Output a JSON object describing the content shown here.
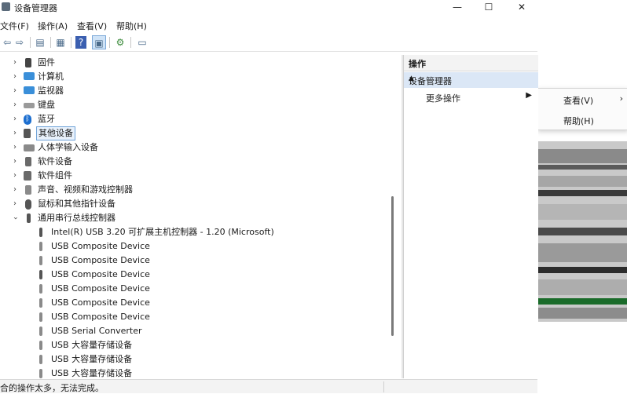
{
  "window": {
    "title": "设备管理器",
    "controls": {
      "minimize": "—",
      "maximize": "☐",
      "close": "✕"
    }
  },
  "menubar": {
    "file": "文件(F)",
    "action": "操作(A)",
    "view": "查看(V)",
    "help": "帮助(H)"
  },
  "toolbar": {
    "back": "back-icon",
    "forward": "forward-icon",
    "properties": "properties-icon",
    "show_hide": "show-hide-icon",
    "help": "help-icon",
    "update": "update-driver-icon",
    "scan": "scan-icon",
    "monitor": "monitor-icon"
  },
  "tree": {
    "items": [
      {
        "label": "固件",
        "expanded": false,
        "icon": "firmware-icon",
        "color": "#444444"
      },
      {
        "label": "计算机",
        "expanded": false,
        "icon": "computer-icon",
        "color": "#3a8fd9"
      },
      {
        "label": "监视器",
        "expanded": false,
        "icon": "monitor-icon",
        "color": "#3a8fd9"
      },
      {
        "label": "键盘",
        "expanded": false,
        "icon": "keyboard-icon",
        "color": "#777777"
      },
      {
        "label": "蓝牙",
        "expanded": false,
        "icon": "bluetooth-icon",
        "color": "#1d6fd0"
      },
      {
        "label": "其他设备",
        "expanded": false,
        "icon": "other-devices-icon",
        "color": "#555555",
        "selected": true
      },
      {
        "label": "人体学输入设备",
        "expanded": false,
        "icon": "hid-icon",
        "color": "#666666"
      },
      {
        "label": "软件设备",
        "expanded": false,
        "icon": "software-device-icon",
        "color": "#666666"
      },
      {
        "label": "软件组件",
        "expanded": false,
        "icon": "software-component-icon",
        "color": "#666666"
      },
      {
        "label": "声音、视频和游戏控制器",
        "expanded": false,
        "icon": "audio-icon",
        "color": "#777777"
      },
      {
        "label": "鼠标和其他指针设备",
        "expanded": false,
        "icon": "mouse-icon",
        "color": "#555555"
      },
      {
        "label": "通用串行总线控制器",
        "expanded": true,
        "icon": "usb-icon",
        "color": "#555555"
      }
    ],
    "usb_children": [
      "Intel(R) USB 3.20 可扩展主机控制器 - 1.20 (Microsoft)",
      "USB Composite Device",
      "USB Composite Device",
      "USB Composite Device",
      "USB Composite Device",
      "USB Composite Device",
      "USB Composite Device",
      "USB Serial Converter",
      "USB 大容量存储设备",
      "USB 大容量存储设备",
      "USB 大容量存储设备"
    ]
  },
  "actions": {
    "header": "操作",
    "section": "设备管理器",
    "more": "更多操作"
  },
  "context_menu": {
    "view": "查看(V)",
    "help": "帮助(H)"
  },
  "status": {
    "text": "合的操作太多，无法完成。"
  }
}
